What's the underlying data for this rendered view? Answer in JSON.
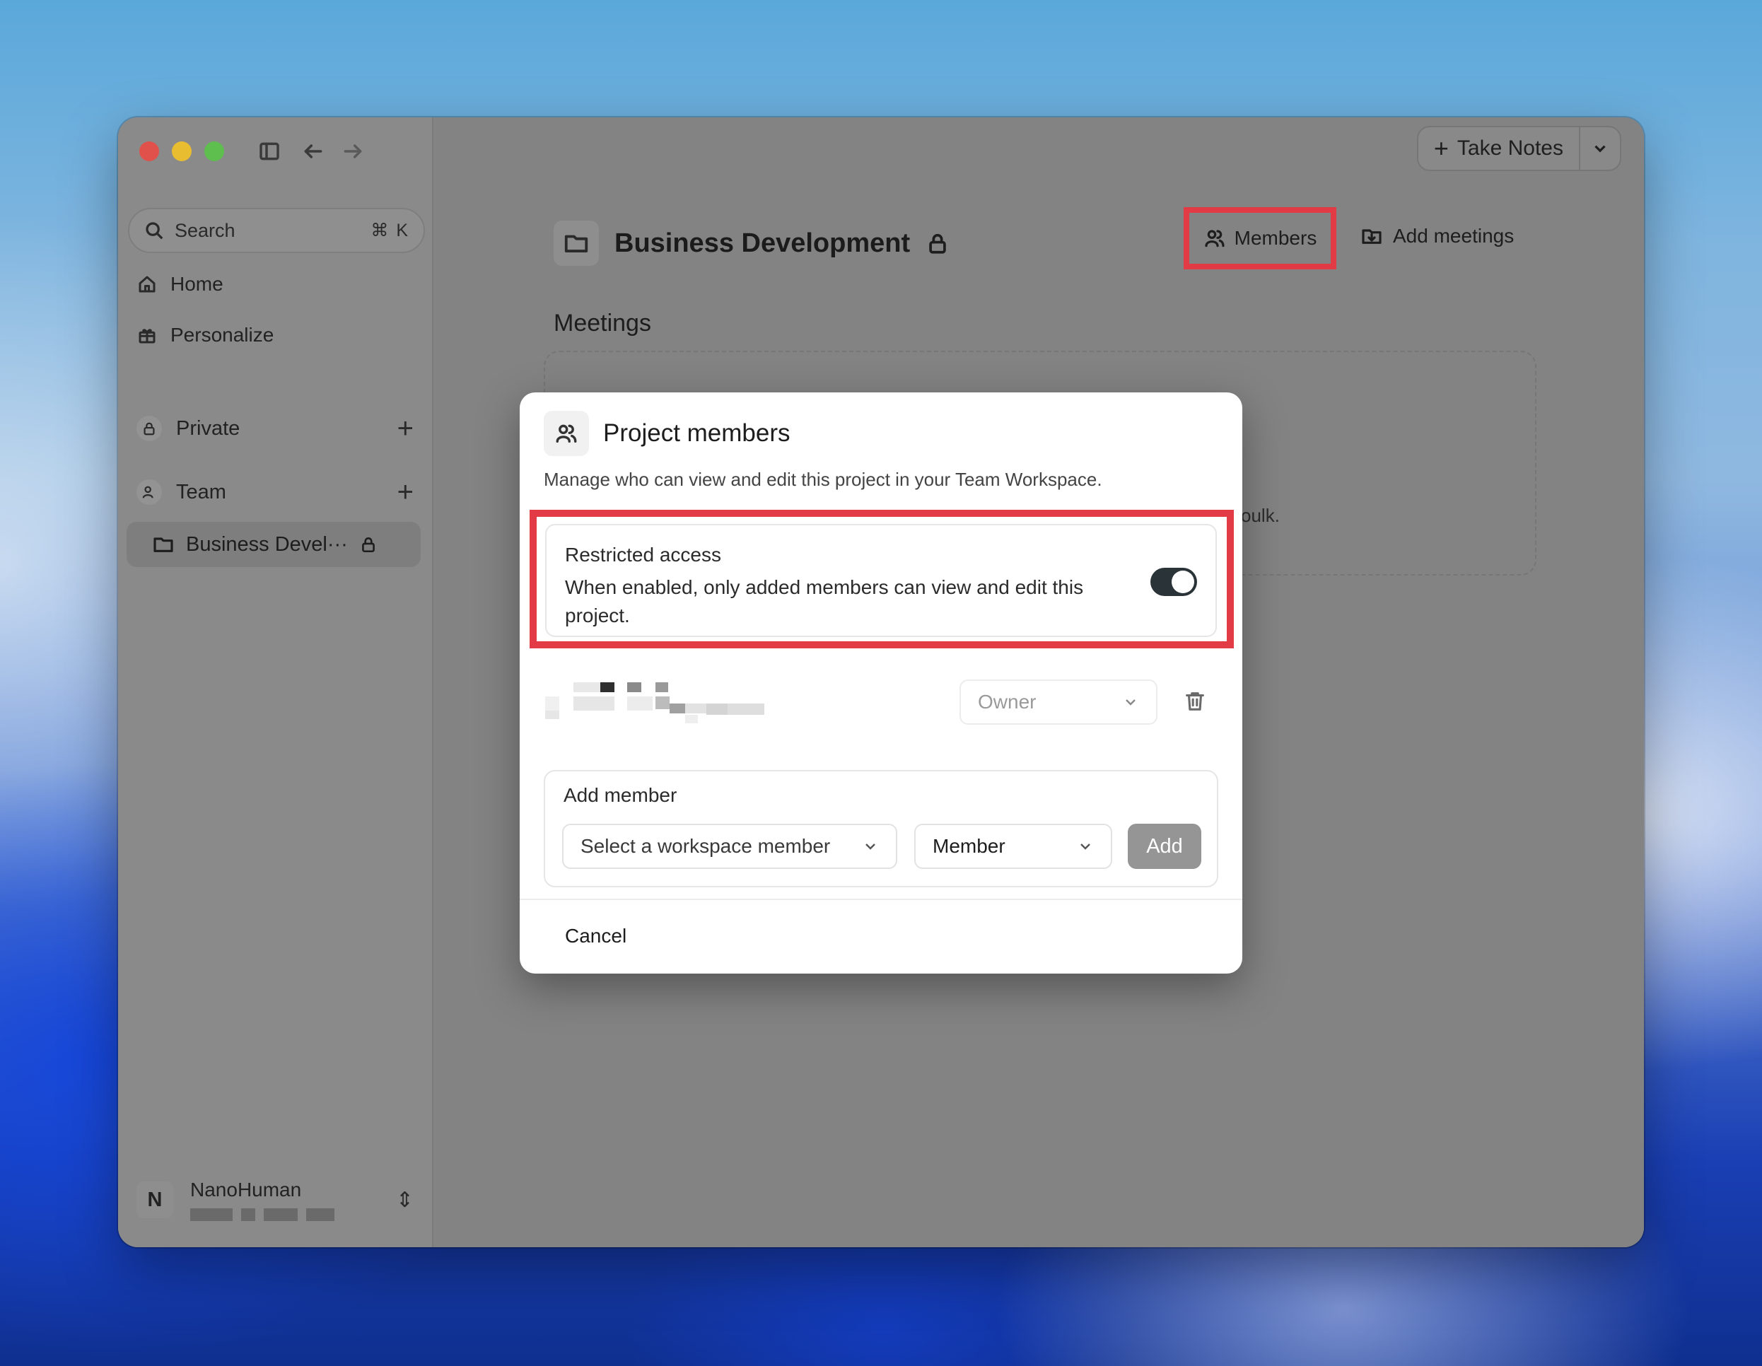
{
  "sidebar": {
    "search": {
      "label": "Search",
      "shortcut": "⌘ K"
    },
    "nav": [
      {
        "label": "Home",
        "icon": "home-icon"
      },
      {
        "label": "Personalize",
        "icon": "personalize-icon"
      }
    ],
    "sections": [
      {
        "label": "Private",
        "icon": "lock-icon"
      },
      {
        "label": "Team",
        "icon": "team-icon"
      }
    ],
    "project": {
      "label": "Business Devel···",
      "icon": "folder-icon"
    },
    "user": {
      "initial": "N",
      "name": "NanoHuman"
    }
  },
  "header": {
    "take_notes": "Take Notes",
    "project_title": "Business Development",
    "members_label": "Members",
    "add_meetings_label": "Add meetings"
  },
  "main": {
    "meetings_title": "Meetings",
    "partial_text": "oulk."
  },
  "modal": {
    "title": "Project members",
    "description": "Manage who can view and edit this project in your Team Workspace.",
    "restricted": {
      "title": "Restricted access",
      "description": "When enabled, only added members can view and edit this project.",
      "enabled": true
    },
    "member_role": "Owner",
    "add_member": {
      "label": "Add member",
      "select_placeholder": "Select a workspace member",
      "role": "Member",
      "button": "Add"
    },
    "cancel": "Cancel"
  },
  "colors": {
    "highlight": "#e33b45",
    "toggle_on": "#2a3338"
  }
}
